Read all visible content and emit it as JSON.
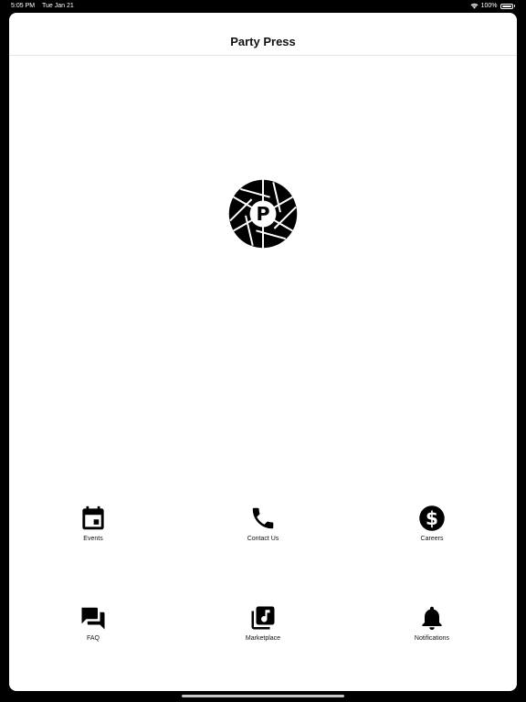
{
  "status_bar": {
    "time": "5:05 PM",
    "date": "Tue Jan 21",
    "battery": "100%"
  },
  "nav": {
    "title": "Party Press"
  },
  "logo": {
    "letter": "P"
  },
  "menu": {
    "events": "Events",
    "contact": "Contact Us",
    "careers": "Careers",
    "faq": "FAQ",
    "marketplace": "Marketplace",
    "notifications": "Notifications"
  },
  "colors": {
    "icon": "#000000",
    "background": "#ffffff",
    "frame": "#000000"
  }
}
